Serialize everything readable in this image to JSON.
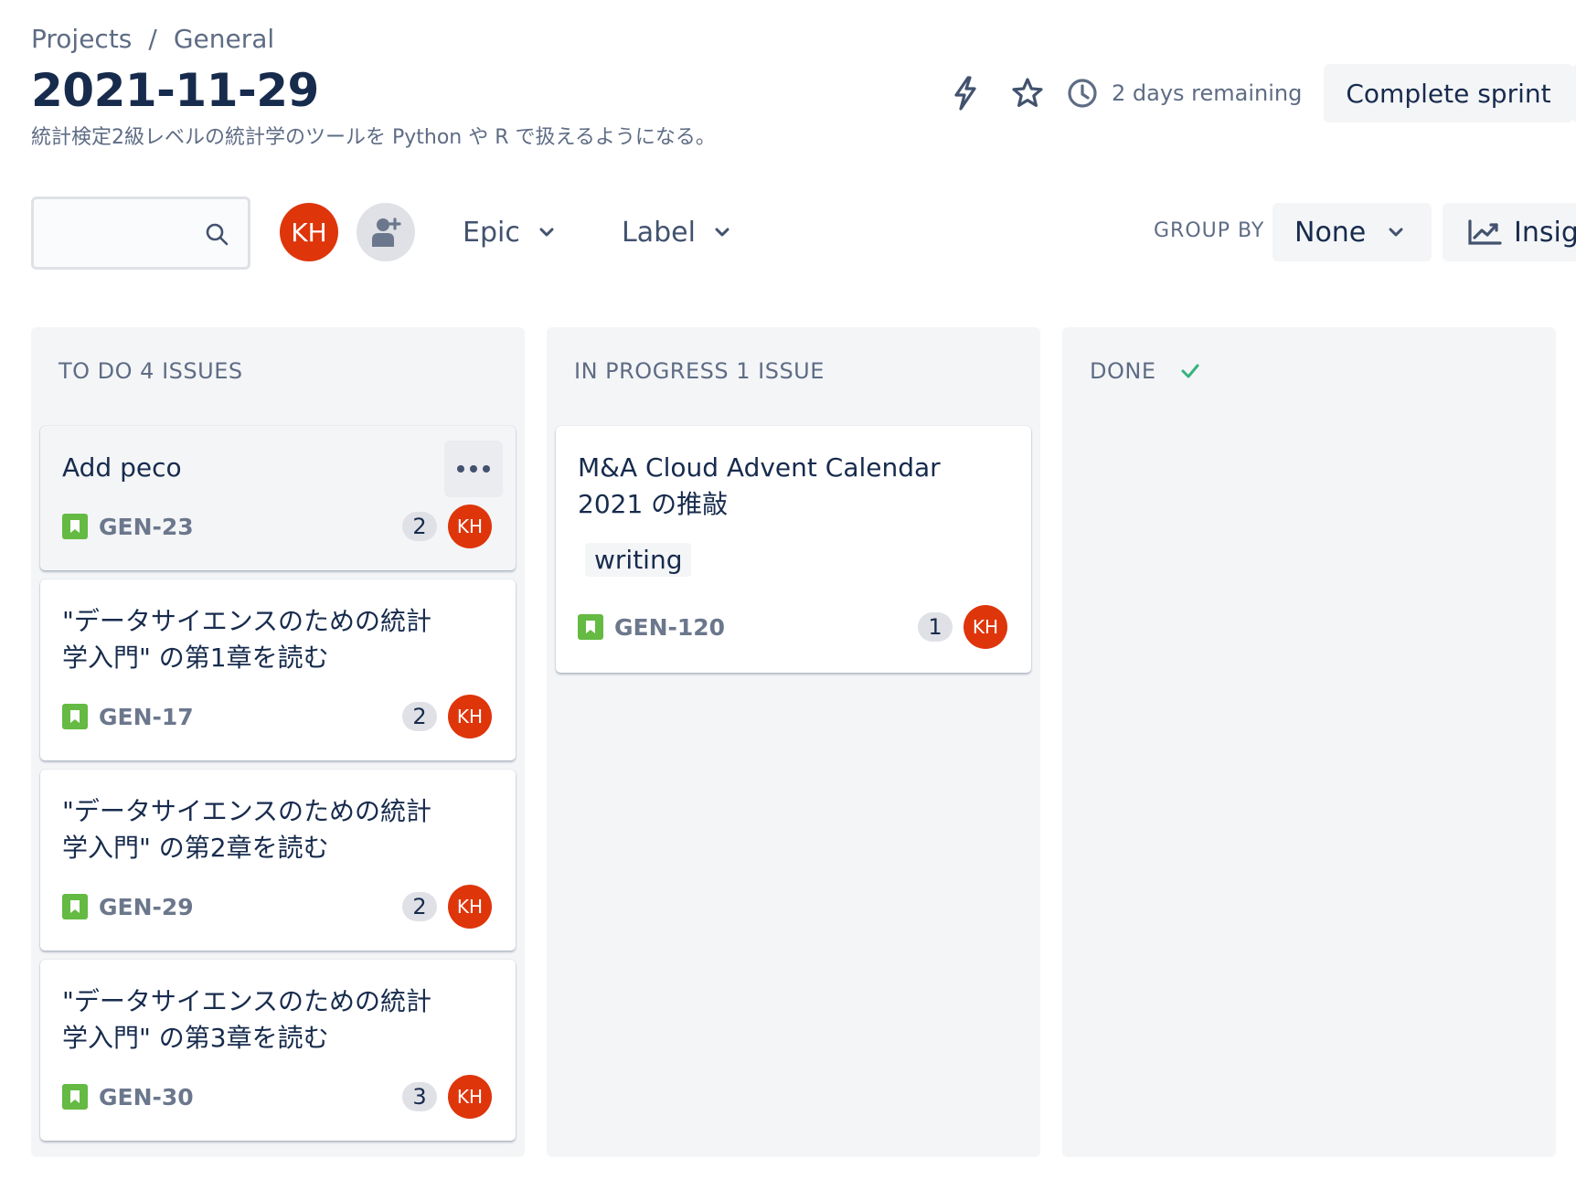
{
  "breadcrumb": {
    "project": "Projects",
    "separator": "/",
    "board": "General"
  },
  "sprint": {
    "title": "2021-11-29",
    "goal": "統計検定2級レベルの統計学のツールを Python や R で扱えるようになる。",
    "remaining": "2 days remaining",
    "complete_label": "Complete sprint"
  },
  "filters": {
    "search_placeholder": "",
    "avatar_initials": "KH",
    "epic_label": "Epic",
    "label_label": "Label",
    "group_by_label": "GROUP BY",
    "group_by_value": "None",
    "insights_label": "Insights"
  },
  "columns": [
    {
      "title": "TO DO 4 ISSUES",
      "cards": [
        {
          "title": "Add peco",
          "key": "GEN-23",
          "points": "2",
          "assignee": "KH"
        },
        {
          "title": "\"データサイエンスのための統計学入門\" の第1章を読む",
          "key": "GEN-17",
          "points": "2",
          "assignee": "KH"
        },
        {
          "title": "\"データサイエンスのための統計学入門\" の第2章を読む",
          "key": "GEN-29",
          "points": "2",
          "assignee": "KH"
        },
        {
          "title": "\"データサイエンスのための統計学入門\" の第3章を読む",
          "key": "GEN-30",
          "points": "3",
          "assignee": "KH"
        }
      ]
    },
    {
      "title": "IN PROGRESS 1 ISSUE",
      "cards": [
        {
          "title": "M&A Cloud Advent Calendar 2021 の推敲",
          "label": "writing",
          "key": "GEN-120",
          "points": "1",
          "assignee": "KH"
        }
      ]
    },
    {
      "title": "DONE",
      "cards": []
    }
  ],
  "colors": {
    "avatar": "#de350b",
    "story": "#65ba43",
    "column_bg": "#f4f5f7",
    "done_check": "#36b37e"
  }
}
